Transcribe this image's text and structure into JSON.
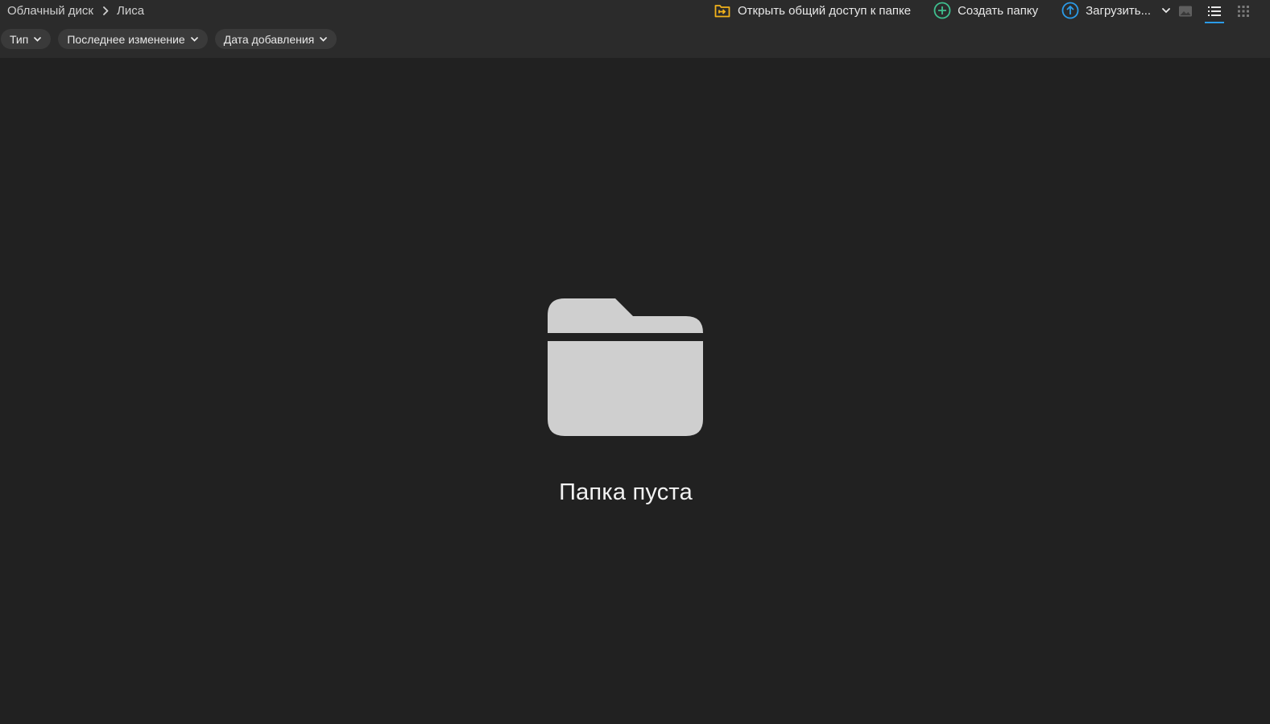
{
  "breadcrumb": {
    "items": [
      "Облачный диск",
      "Лиса"
    ]
  },
  "actions": {
    "share_label": "Открыть общий доступ к папке",
    "create_folder_label": "Создать папку",
    "upload_label": "Загрузить..."
  },
  "view_modes": [
    "gallery",
    "list",
    "grid"
  ],
  "active_view": "list",
  "filters": [
    {
      "label": "Тип"
    },
    {
      "label": "Последнее изменение"
    },
    {
      "label": "Дата добавления"
    }
  ],
  "empty_state": {
    "message": "Папка пуста"
  },
  "colors": {
    "background": "#212121",
    "toolbar": "#2b2b2b",
    "chip": "#3a3a3a",
    "share_icon": "#f2b21b",
    "create_icon": "#3fbf8f",
    "upload_icon": "#2b9be8",
    "active_view_underline": "#2b9be8",
    "folder_icon": "#cfcfcf"
  }
}
